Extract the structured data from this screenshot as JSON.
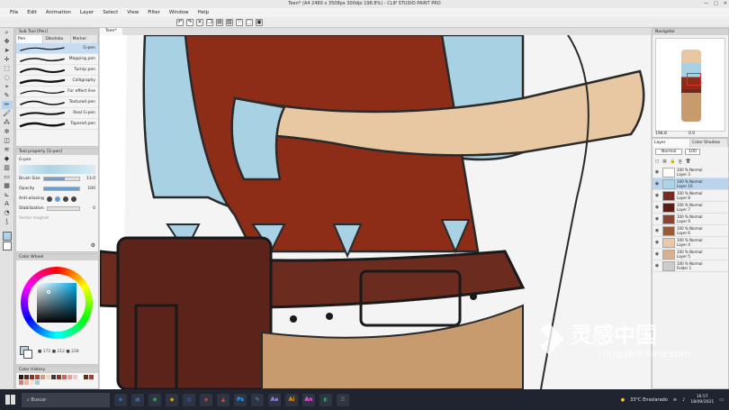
{
  "window": {
    "title": "Teen* (A4 2480 x 3508px 300dpi 198.8%) - CLIP STUDIO PAINT PRO",
    "controls": [
      "—",
      "□",
      "✕"
    ]
  },
  "menu": [
    "File",
    "Edit",
    "Animation",
    "Layer",
    "Select",
    "View",
    "Filter",
    "Window",
    "Help"
  ],
  "canvas_tab": "Teen*",
  "subtool": {
    "header": "Sub Tool [Pen]",
    "tabs": [
      "Pen",
      "Dibotsbo",
      "Marker"
    ],
    "brushes": [
      "G-pen",
      "Mapping pen",
      "Turnip pen",
      "Calligraphy",
      "For effect line",
      "Textured pen",
      "Real G-pen",
      "Tapered pen"
    ],
    "active_index": 0
  },
  "tool_property": {
    "header": "Tool property [G-pen]",
    "name": "G-pen",
    "brush_size_label": "Brush Size",
    "brush_size_value": "13.0",
    "opacity_label": "Opacity",
    "opacity_value": "100",
    "antialiasing_label": "Anti-aliasing",
    "stabilization_label": "Stabilization",
    "stabilization_value": "0",
    "vector_magnet_label": "Vector magnet"
  },
  "color_wheel": {
    "header": "Color Wheel",
    "rgb_readout": "■ 172 ■ 212 ■ 228",
    "main_color": "#acd4e4"
  },
  "color_history": {
    "header": "Color History",
    "swatches": [
      "#2b1a12",
      "#5a2a20",
      "#8a3220",
      "#b04a2a",
      "#d29d83",
      "#f2d7c0",
      "#3a3a3a",
      "#7a3a2e",
      "#c86a5a",
      "#e8a0a0",
      "#f0c8c8",
      "#ffffff",
      "#6a2a1a",
      "#a04030",
      "#d08070",
      "#f0b0a0",
      "#ffe0d0",
      "#9ad0e0"
    ]
  },
  "navigator": {
    "header": "Navigator",
    "zoom": "198.8",
    "angle": "0.0"
  },
  "layer_panel": {
    "tabs": [
      "Layer",
      "Color Shadow"
    ],
    "blend_mode": "Normal",
    "opacity": "100",
    "layers": [
      {
        "opacity": "100 %",
        "mode": "Normal",
        "name": "Layer 3",
        "thumb": "#ffffff"
      },
      {
        "opacity": "100 %",
        "mode": "Normal",
        "name": "Layer 10",
        "thumb": "#acd4e4"
      },
      {
        "opacity": "100 %",
        "mode": "Normal",
        "name": "Layer 8",
        "thumb": "#7a2a22"
      },
      {
        "opacity": "100 %",
        "mode": "Normal",
        "name": "Layer 7",
        "thumb": "#5a1e18"
      },
      {
        "opacity": "100 %",
        "mode": "Normal",
        "name": "Layer 9",
        "thumb": "#8c4430"
      },
      {
        "opacity": "100 %",
        "mode": "Normal",
        "name": "Layer 6",
        "thumb": "#9a5a3a"
      },
      {
        "opacity": "100 %",
        "mode": "Normal",
        "name": "Layer 4",
        "thumb": "#e8c8a8"
      },
      {
        "opacity": "100 %",
        "mode": "Normal",
        "name": "Layer 5",
        "thumb": "#d8b090"
      },
      {
        "opacity": "100 %",
        "mode": "Normal",
        "name": "Folder 1",
        "thumb": "#cccccc"
      }
    ],
    "active_index": 1
  },
  "taskbar": {
    "search_placeholder": "Buscar",
    "apps": [
      {
        "label": "e",
        "color": "#2a7fd4"
      },
      {
        "label": "▣",
        "color": "#3a6ea5"
      },
      {
        "label": "◉",
        "color": "#2fb14a"
      },
      {
        "label": "◆",
        "color": "#e0a100"
      },
      {
        "label": "◎",
        "color": "#5865f2"
      },
      {
        "label": "◈",
        "color": "#ea4335"
      },
      {
        "label": "▲",
        "color": "#d24726"
      },
      {
        "label": "Ps",
        "color": "#31a8ff"
      },
      {
        "label": "✎",
        "color": "#6a9fd3"
      },
      {
        "label": "Ae",
        "color": "#9999ff"
      },
      {
        "label": "Ai",
        "color": "#ff9a00"
      },
      {
        "label": "An",
        "color": "#ff61f6"
      },
      {
        "label": "◐",
        "color": "#1db954"
      },
      {
        "label": "☰",
        "color": "#777777"
      }
    ],
    "weather": "33°C  Ensolarado",
    "time": "16:57",
    "date": "18/09/2021"
  },
  "watermark": {
    "main": "灵感中国",
    "url": "lingganchina.com"
  }
}
